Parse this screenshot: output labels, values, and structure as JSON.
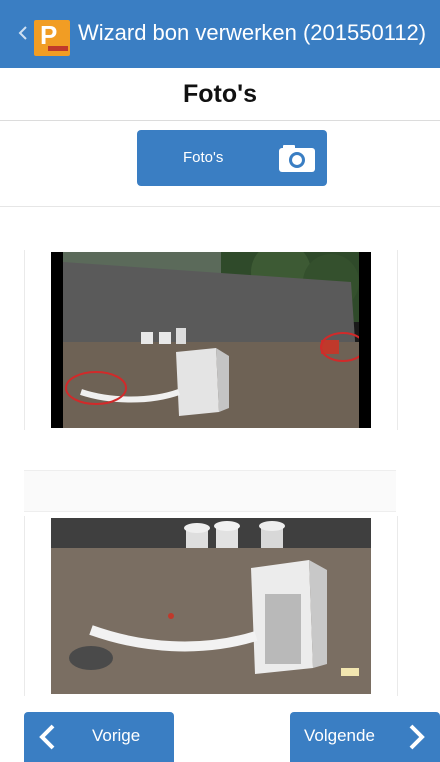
{
  "appbar": {
    "title": "Wizard bon verwerken (201550112)",
    "accent": "#3a7ec3",
    "logo_color": "#f19d24",
    "logo_letter": "P"
  },
  "page": {
    "title": "Foto's"
  },
  "photo_button": {
    "label": "Foto's",
    "icon": "camera-icon"
  },
  "photos": [
    {
      "name": "photo-1",
      "description_icon": "image"
    },
    {
      "name": "photo-2",
      "description_icon": "image"
    }
  ],
  "nav": {
    "prev_label": "Vorige",
    "next_label": "Volgende",
    "prev_icon": "chevron-left-icon",
    "next_icon": "chevron-right-icon"
  }
}
